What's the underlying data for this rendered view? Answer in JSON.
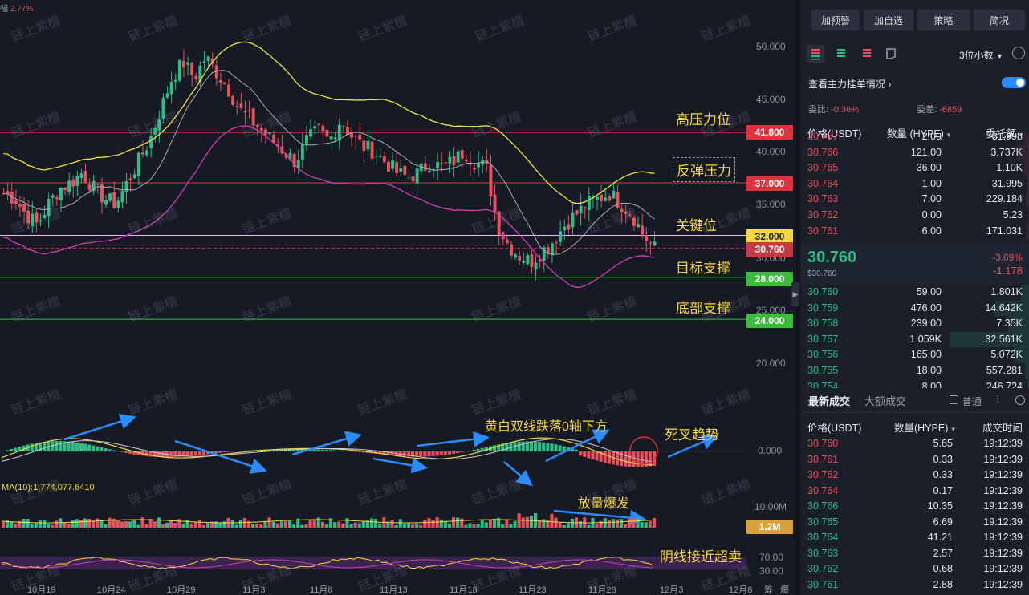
{
  "top_left_badge": {
    "prefix": "幅",
    "pct": "2.77%"
  },
  "watermark_text": "链上紫檀",
  "price_axis": [
    "50.000",
    "45.000",
    "40.000",
    "35.000",
    "30.000",
    "25.000",
    "20.000"
  ],
  "indicator_axis": {
    "macd_zero": "0.000",
    "vol_max": "10.00M",
    "rsi_hi": "70.00",
    "rsi_lo": "30.00"
  },
  "level_tags": [
    {
      "label": "41.800",
      "color": "#e0313d",
      "text_color": "#ffffff"
    },
    {
      "label": "37.000",
      "color": "#e0313d",
      "text_color": "#ffffff"
    },
    {
      "label": "32.000",
      "color": "#f5d742",
      "text_color": "#1b1f2a"
    },
    {
      "label": "30.760",
      "color": "#c63a45",
      "text_color": "#ffffff"
    },
    {
      "label": "28.000",
      "color": "#3dbb3d",
      "text_color": "#ffffff"
    },
    {
      "label": "24.000",
      "color": "#3dbb3d",
      "text_color": "#ffffff"
    }
  ],
  "vol_tag": {
    "label": "1.2M",
    "color": "#d9a13a"
  },
  "annotations": {
    "resistance": "高压力位",
    "rebound": "反弹压力",
    "key": "关键位",
    "target": "目标支撑",
    "bottom": "底部支撑",
    "macd_note": "黄白双线跌落0轴下方",
    "death_cross": "死叉趋势",
    "volume_note": "放量爆发",
    "rsi_note": "阴线接近超卖"
  },
  "ma_label": "MA(10):1,774,077.6410",
  "dates": [
    "10月19",
    "10月24",
    "10月29",
    "11月3",
    "11月8",
    "11月13",
    "11月18",
    "11月23",
    "11月28",
    "12月3",
    "12月8"
  ],
  "corner_labels": [
    "筹",
    "爆"
  ],
  "colors": {
    "up": "#2ebd85",
    "down": "#e9515c",
    "accent": "#2b8cff",
    "yellow": "#f5d742"
  },
  "panel": {
    "buttons": [
      "加预警",
      "加自选",
      "策略",
      "简况"
    ],
    "toolbar_icons": [
      "orderbook-both-icon",
      "orderbook-buy-icon",
      "orderbook-sell-icon",
      "expand-icon"
    ],
    "decimals": "3位小数",
    "main_force_label": "查看主力挂单情况",
    "main_force_toggle": true,
    "ratio_label": "委比:",
    "ratio_value": "-0.36%",
    "diff_label": "委差:",
    "diff_value": "-6859",
    "headers": {
      "price": "价格(USDT)",
      "qty": "数量 (HYPE)",
      "total": "委托额"
    },
    "asks": [
      {
        "price": "30.767",
        "qty": "2.00",
        "total": "31.998",
        "depth": 0.05
      },
      {
        "price": "30.766",
        "qty": "121.00",
        "total": "3.737K",
        "depth": 0.12
      },
      {
        "price": "30.765",
        "qty": "36.00",
        "total": "1.10K",
        "depth": 0.05
      },
      {
        "price": "30.764",
        "qty": "1.00",
        "total": "31.995",
        "depth": 0.02
      },
      {
        "price": "30.763",
        "qty": "7.00",
        "total": "229.184",
        "depth": 0.03
      },
      {
        "price": "30.762",
        "qty": "0.00",
        "total": "5.23",
        "depth": 0.01
      },
      {
        "price": "30.761",
        "qty": "6.00",
        "total": "171.031",
        "depth": 0.03
      }
    ],
    "last_price": "30.760",
    "last_price_usd": "$30.760",
    "change_pct": "-3.69%",
    "change_abs": "-1.178",
    "bids": [
      {
        "price": "30.760",
        "qty": "59.00",
        "total": "1.801K",
        "depth": 0.08
      },
      {
        "price": "30.759",
        "qty": "476.00",
        "total": "14.642K",
        "depth": 0.36
      },
      {
        "price": "30.758",
        "qty": "239.00",
        "total": "7.35K",
        "depth": 0.22
      },
      {
        "price": "30.757",
        "qty": "1.059K",
        "total": "32.561K",
        "depth": 0.82
      },
      {
        "price": "30.756",
        "qty": "165.00",
        "total": "5.072K",
        "depth": 0.16
      },
      {
        "price": "30.755",
        "qty": "18.00",
        "total": "557.281",
        "depth": 0.04
      },
      {
        "price": "30.754",
        "qty": "8.00",
        "total": "246.724",
        "depth": 0.02
      }
    ],
    "trades_tabs": [
      "最新成交",
      "大额成交"
    ],
    "normal_label": "普通",
    "trade_headers": {
      "price": "价格(USDT)",
      "qty": "数量(HYPE)",
      "time": "成交时间"
    },
    "trades": [
      {
        "price": "30.760",
        "qty": "5.85",
        "time": "19:12:39",
        "side": "sell"
      },
      {
        "price": "30.761",
        "qty": "0.33",
        "time": "19:12:39",
        "side": "sell"
      },
      {
        "price": "30.762",
        "qty": "0.33",
        "time": "19:12:39",
        "side": "sell"
      },
      {
        "price": "30.764",
        "qty": "0.17",
        "time": "19:12:39",
        "side": "sell"
      },
      {
        "price": "30.766",
        "qty": "10.35",
        "time": "19:12:39",
        "side": "buy"
      },
      {
        "price": "30.765",
        "qty": "6.69",
        "time": "19:12:39",
        "side": "buy"
      },
      {
        "price": "30.764",
        "qty": "41.21",
        "time": "19:12:39",
        "side": "buy"
      },
      {
        "price": "30.763",
        "qty": "2.57",
        "time": "19:12:39",
        "side": "buy"
      },
      {
        "price": "30.762",
        "qty": "0.68",
        "time": "19:12:39",
        "side": "buy"
      },
      {
        "price": "30.761",
        "qty": "2.88",
        "time": "19:12:39",
        "side": "buy"
      }
    ]
  },
  "chart_data": {
    "type": "candlestick",
    "x_labels": [
      "10月19",
      "10月24",
      "10月29",
      "11月3",
      "11月8",
      "11月13",
      "11月18",
      "11月23",
      "11月28",
      "12月3",
      "12月8"
    ],
    "price_range": [
      16,
      53
    ],
    "close_path": [
      36,
      35.5,
      34,
      33,
      35,
      36.5,
      37,
      38,
      36.5,
      35.5,
      35,
      37,
      39,
      41,
      44,
      47,
      48.5,
      47,
      49,
      47.5,
      46,
      44,
      43,
      42,
      41,
      40,
      39,
      41,
      42,
      41,
      43,
      41.5,
      40.5,
      40,
      39,
      38,
      37.5,
      38,
      39,
      38.5,
      39,
      40,
      39,
      38.5,
      33,
      31,
      30,
      29.5,
      30.5,
      31.5,
      33,
      34,
      35,
      35.5,
      36,
      35,
      34,
      32,
      30.76
    ],
    "levels": [
      41.8,
      37.0,
      32.0,
      30.76,
      28.0,
      24.0
    ],
    "indicators": [
      "MACD",
      "VOL MA(10)",
      "RSI"
    ]
  }
}
